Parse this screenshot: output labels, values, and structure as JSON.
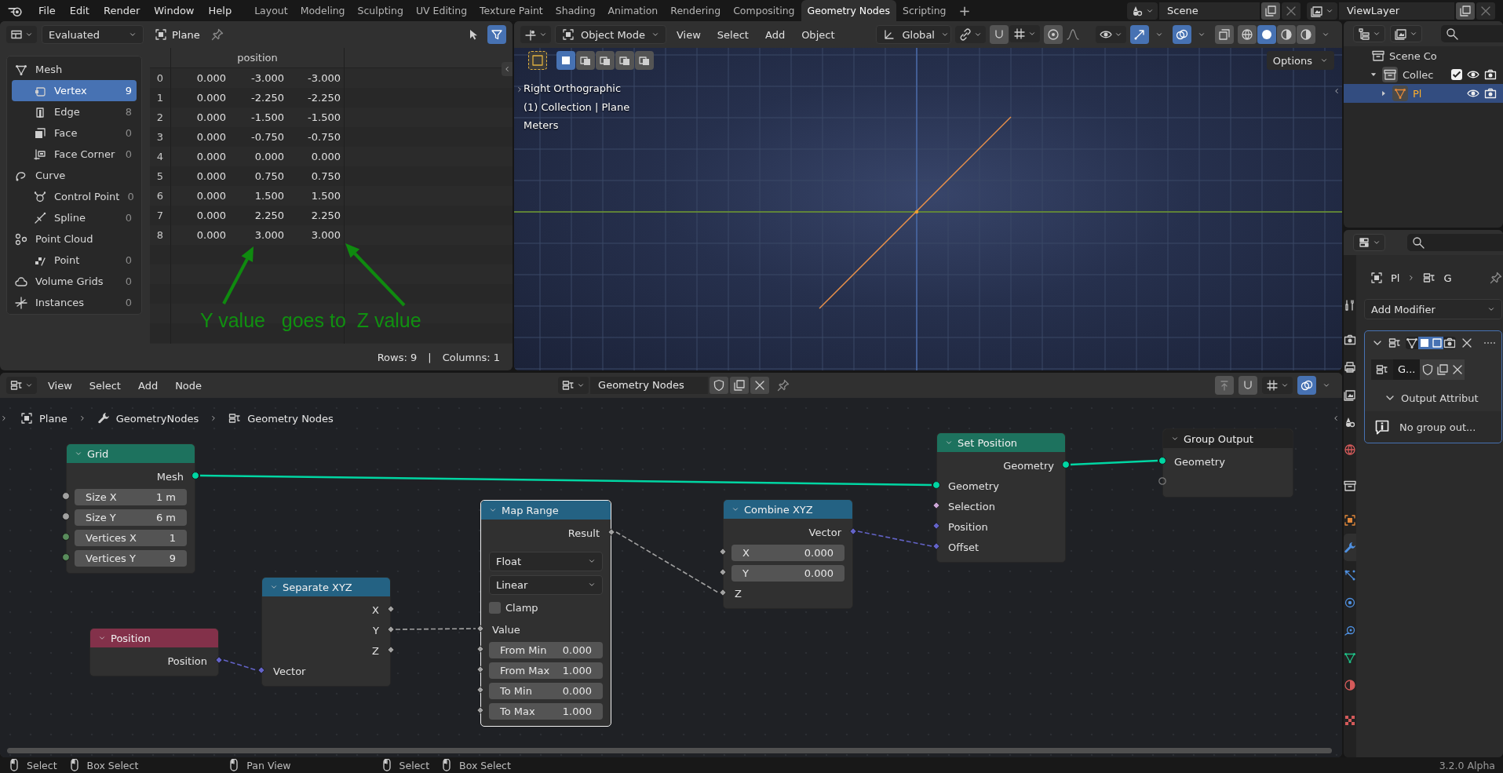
{
  "topbar": {
    "menus": [
      "File",
      "Edit",
      "Render",
      "Window",
      "Help"
    ],
    "workspaces": [
      {
        "label": "Layout",
        "selected": false
      },
      {
        "label": "Modeling",
        "selected": false
      },
      {
        "label": "Sculpting",
        "selected": false
      },
      {
        "label": "UV Editing",
        "selected": false
      },
      {
        "label": "Texture Paint",
        "selected": false
      },
      {
        "label": "Shading",
        "selected": false
      },
      {
        "label": "Animation",
        "selected": false
      },
      {
        "label": "Rendering",
        "selected": false
      },
      {
        "label": "Compositing",
        "selected": false
      },
      {
        "label": "Geometry Nodes",
        "selected": true
      },
      {
        "label": "Scripting",
        "selected": false
      }
    ],
    "add_workspace": "+",
    "scene": "Scene",
    "view_layer": "ViewLayer"
  },
  "spreadsheet": {
    "mode": "Evaluated",
    "object": "Plane",
    "filter_on": true,
    "domains": [
      {
        "label": "Mesh",
        "children": [
          {
            "label": "Vertex",
            "count": "9",
            "selected": true
          },
          {
            "label": "Edge",
            "count": "8",
            "selected": false
          },
          {
            "label": "Face",
            "count": "0",
            "selected": false
          },
          {
            "label": "Face Corner",
            "count": "0",
            "selected": false
          }
        ]
      },
      {
        "label": "Curve",
        "children": [
          {
            "label": "Control Point",
            "count": "0",
            "selected": false
          },
          {
            "label": "Spline",
            "count": "0",
            "selected": false
          }
        ]
      },
      {
        "label": "Point Cloud",
        "children": [
          {
            "label": "Point",
            "count": "0",
            "selected": false
          }
        ]
      },
      {
        "label": "Volume Grids",
        "count": "0",
        "selected": false
      },
      {
        "label": "Instances",
        "count": "0",
        "selected": false
      }
    ],
    "column": "position",
    "rows": [
      {
        "index": "0",
        "values": [
          "0.000",
          "-3.000",
          "-3.000"
        ]
      },
      {
        "index": "1",
        "values": [
          "0.000",
          "-2.250",
          "-2.250"
        ]
      },
      {
        "index": "2",
        "values": [
          "0.000",
          "-1.500",
          "-1.500"
        ]
      },
      {
        "index": "3",
        "values": [
          "0.000",
          "-0.750",
          "-0.750"
        ]
      },
      {
        "index": "4",
        "values": [
          "0.000",
          "0.000",
          "0.000"
        ]
      },
      {
        "index": "5",
        "values": [
          "0.000",
          "0.750",
          "0.750"
        ]
      },
      {
        "index": "6",
        "values": [
          "0.000",
          "1.500",
          "1.500"
        ]
      },
      {
        "index": "7",
        "values": [
          "0.000",
          "2.250",
          "2.250"
        ]
      },
      {
        "index": "8",
        "values": [
          "0.000",
          "3.000",
          "3.000"
        ]
      }
    ],
    "annotation": "Y value   goes to  Z value",
    "row_count": "Rows: 9",
    "separator": "|",
    "column_count": "Columns: 1"
  },
  "viewport": {
    "mode": "Object Mode",
    "menus": [
      "View",
      "Select",
      "Add",
      "Object"
    ],
    "orientation": "Global",
    "select_modes": [
      {
        "selected": true
      },
      {
        "selected": false
      },
      {
        "selected": false
      },
      {
        "selected": false
      },
      {
        "selected": false
      }
    ],
    "gizmos_on": true,
    "overlays_on": true,
    "xray_on": false,
    "shading_modes": [
      {
        "selected": false
      },
      {
        "selected": true
      },
      {
        "selected": false
      },
      {
        "selected": false
      }
    ],
    "options": "Options",
    "info": [
      "Right Orthographic",
      "(1) Collection | Plane",
      "Meters"
    ]
  },
  "outliner": {
    "items": [
      {
        "label": "Scene Co",
        "selected": false,
        "children": [
          {
            "label": "Collec",
            "selected": false,
            "expanded": true,
            "checked": true,
            "children": [
              {
                "label": "Pl",
                "selected": true,
                "expanded": false
              }
            ]
          }
        ]
      }
    ]
  },
  "properties": {
    "tabs": [
      {
        "selected": false
      },
      {
        "selected": false
      },
      {
        "selected": false
      },
      {
        "selected": false
      },
      {
        "selected": false
      },
      {
        "selected": false
      },
      {
        "selected": false
      },
      {
        "selected": false
      },
      {
        "selected": true
      },
      {
        "selected": false
      },
      {
        "selected": false
      },
      {
        "selected": false
      },
      {
        "selected": false
      },
      {
        "selected": false
      },
      {
        "selected": false
      }
    ],
    "breadcrumb": [
      "Pl",
      "G"
    ],
    "add_modifier": "Add Modifier",
    "modifier": {
      "expanded": true,
      "node_group": "G...",
      "subpanel": "Output Attribut",
      "subpanel_expanded": true,
      "message": "No group out..."
    }
  },
  "node_editor": {
    "menus": [
      "View",
      "Select",
      "Add",
      "Node"
    ],
    "node_group": "Geometry Nodes",
    "overlays_on": true,
    "breadcrumb": [
      "Plane",
      "GeometryNodes",
      "Geometry Nodes"
    ],
    "nodes": [
      {
        "title": "Grid",
        "color": "#1d725e",
        "selected": false,
        "rows": [
          {
            "kind": "output",
            "label": "Mesh"
          },
          {
            "kind": "field",
            "label": "Size X",
            "value": "1 m"
          },
          {
            "kind": "field",
            "label": "Size Y",
            "value": "6 m"
          },
          {
            "kind": "field",
            "label": "Vertices X",
            "value": "1"
          },
          {
            "kind": "field",
            "label": "Vertices Y",
            "value": "9"
          }
        ]
      },
      {
        "title": "Position",
        "color": "#83314a",
        "selected": false,
        "rows": [
          {
            "kind": "output",
            "label": "Position"
          }
        ]
      },
      {
        "title": "Separate XYZ",
        "color": "#246283",
        "selected": false,
        "rows": [
          {
            "kind": "output",
            "label": "X"
          },
          {
            "kind": "output",
            "label": "Y"
          },
          {
            "kind": "output",
            "label": "Z"
          },
          {
            "kind": "input",
            "label": "Vector"
          }
        ]
      },
      {
        "title": "Map Range",
        "color": "#246283",
        "selected": true,
        "rows": [
          {
            "kind": "output",
            "label": "Result"
          },
          {
            "kind": "dropdown",
            "label": "Float"
          },
          {
            "kind": "dropdown",
            "label": "Linear"
          },
          {
            "kind": "checkbox",
            "label": "Clamp",
            "checked": false
          },
          {
            "kind": "input",
            "label": "Value"
          },
          {
            "kind": "field",
            "label": "From Min",
            "value": "0.000"
          },
          {
            "kind": "field",
            "label": "From Max",
            "value": "1.000"
          },
          {
            "kind": "field",
            "label": "To Min",
            "value": "0.000"
          },
          {
            "kind": "field",
            "label": "To Max",
            "value": "1.000"
          }
        ]
      },
      {
        "title": "Combine XYZ",
        "color": "#246283",
        "selected": false,
        "rows": [
          {
            "kind": "output",
            "label": "Vector"
          },
          {
            "kind": "field",
            "label": "X",
            "value": "0.000"
          },
          {
            "kind": "field",
            "label": "Y",
            "value": "0.000"
          },
          {
            "kind": "input",
            "label": "Z"
          }
        ]
      },
      {
        "title": "Set Position",
        "color": "#1d725e",
        "selected": false,
        "rows": [
          {
            "kind": "output",
            "label": "Geometry"
          },
          {
            "kind": "input",
            "label": "Geometry"
          },
          {
            "kind": "input",
            "label": "Selection"
          },
          {
            "kind": "input",
            "label": "Position"
          },
          {
            "kind": "input",
            "label": "Offset"
          }
        ]
      },
      {
        "title": "Group Output",
        "color": "#232323",
        "selected": false,
        "rows": [
          {
            "kind": "input",
            "label": "Geometry"
          },
          {
            "kind": "input"
          }
        ]
      }
    ]
  },
  "status_bar": {
    "hints": [
      "Select",
      "Box Select",
      "Pan View",
      "Select",
      "Box Select"
    ],
    "version": "3.2.0 Alpha"
  }
}
